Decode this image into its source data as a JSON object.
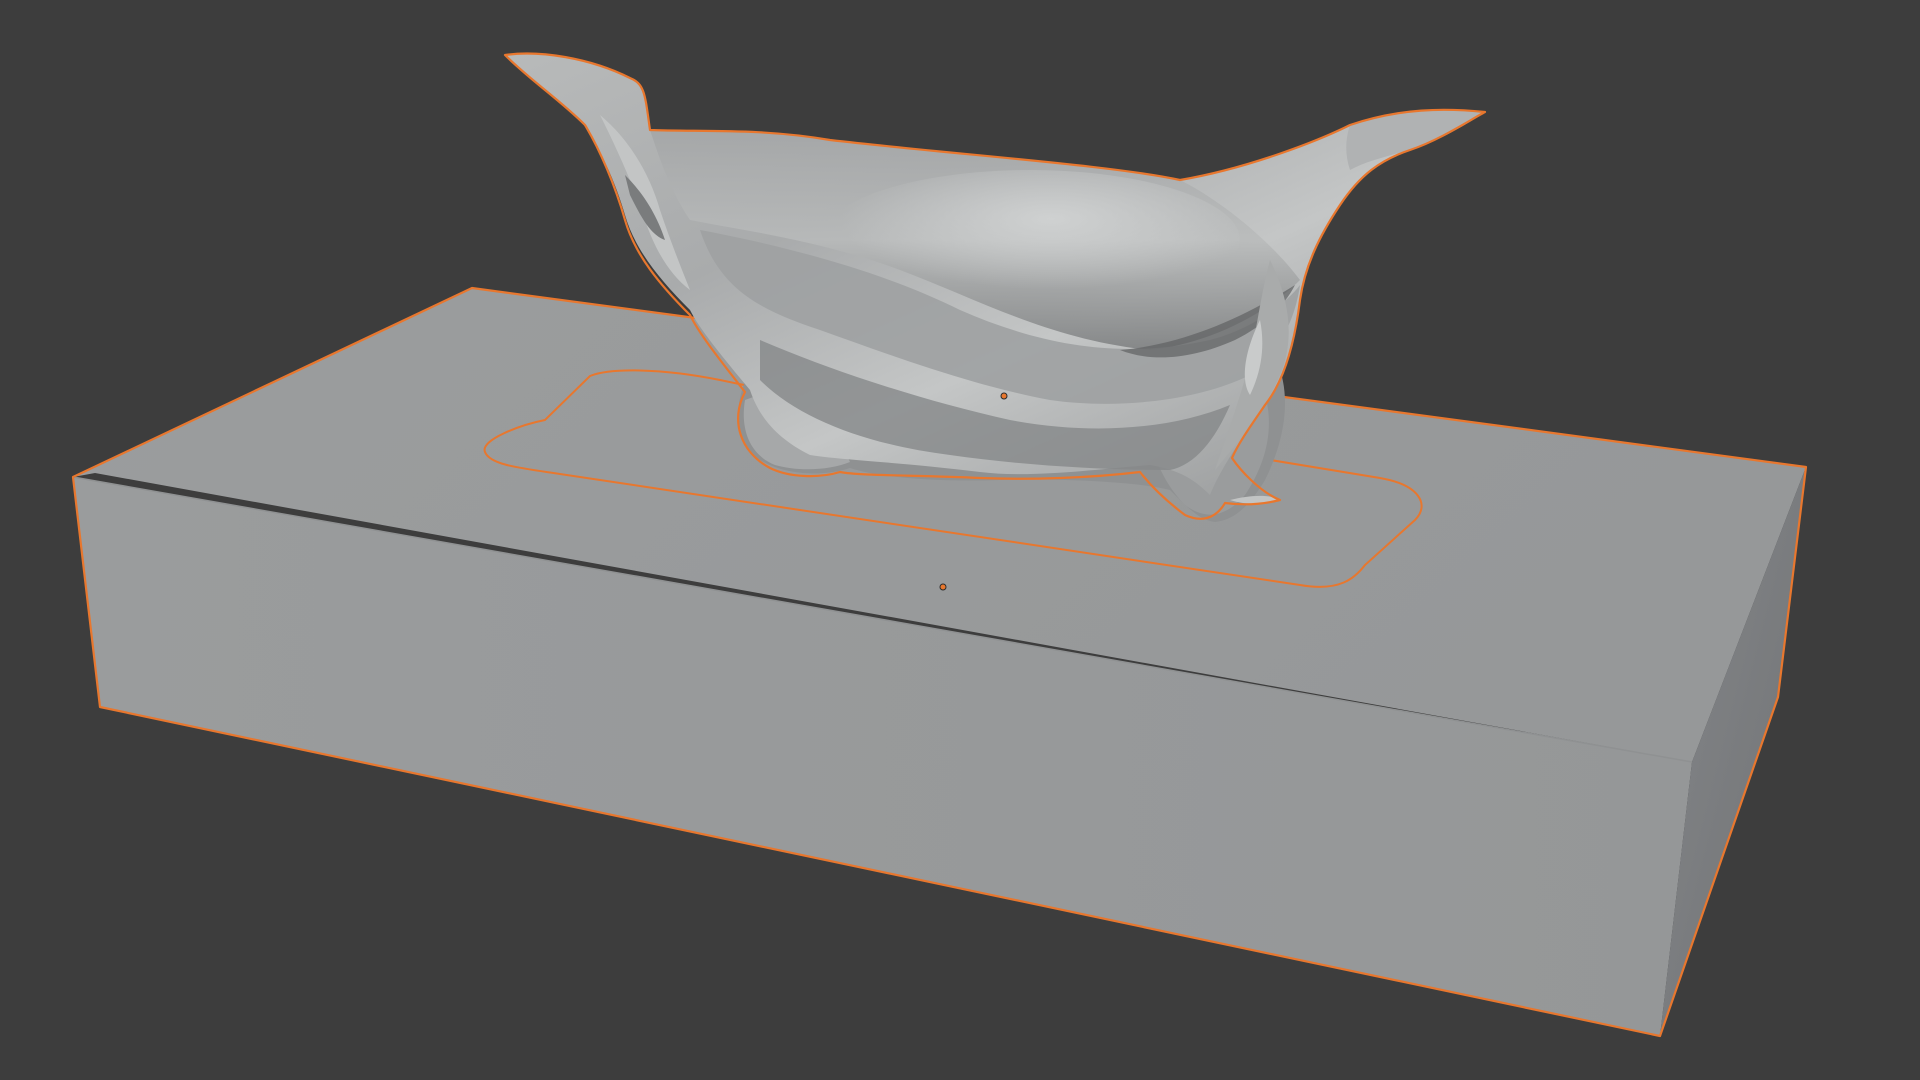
{
  "viewport": {
    "background_color": "#3d3d3d",
    "selection_outline_color": "#e8772e",
    "origin_dot_color": "#e8772e"
  },
  "objects": [
    {
      "kind": "box-base",
      "selected": true,
      "shade_top": "#999b9c",
      "shade_front": "#97999a",
      "shade_side": "#7d7f81"
    },
    {
      "kind": "tissue-sheet",
      "selected": true,
      "shade_base": "#a4a6a7",
      "shade_highlight": "#c8caca",
      "shade_shadow": "#6a6c6d"
    }
  ]
}
